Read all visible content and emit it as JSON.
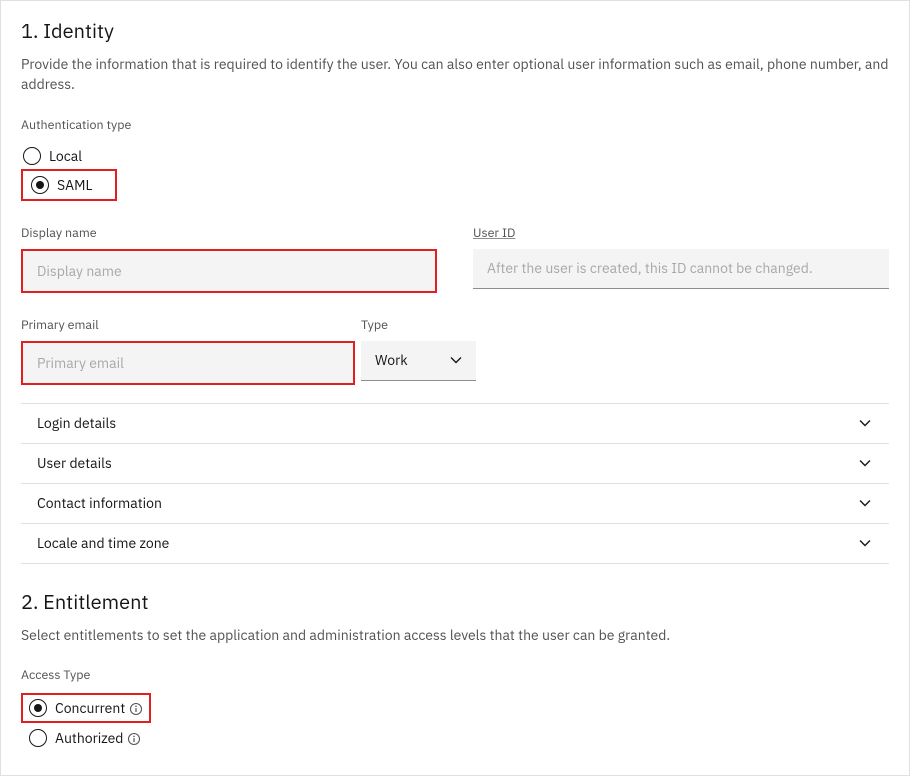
{
  "section1": {
    "title": "1. Identity",
    "description": "Provide the information that is required to identify the user. You can also enter optional user information such as email, phone number, and address.",
    "auth_type_label": "Authentication type",
    "auth_options": {
      "local": "Local",
      "saml": "SAML"
    },
    "display_name": {
      "label": "Display name",
      "placeholder": "Display name"
    },
    "user_id": {
      "label": "User ID",
      "placeholder": "After the user is created, this ID cannot be changed."
    },
    "primary_email": {
      "label": "Primary email",
      "placeholder": "Primary email"
    },
    "email_type": {
      "label": "Type",
      "value": "Work"
    },
    "accordions": [
      "Login details",
      "User details",
      "Contact information",
      "Locale and time zone"
    ]
  },
  "section2": {
    "title": "2. Entitlement",
    "description": "Select entitlements to set the application and administration access levels that the user can be granted.",
    "access_type_label": "Access Type",
    "access_options": {
      "concurrent": "Concurrent",
      "authorized": "Authorized"
    }
  }
}
